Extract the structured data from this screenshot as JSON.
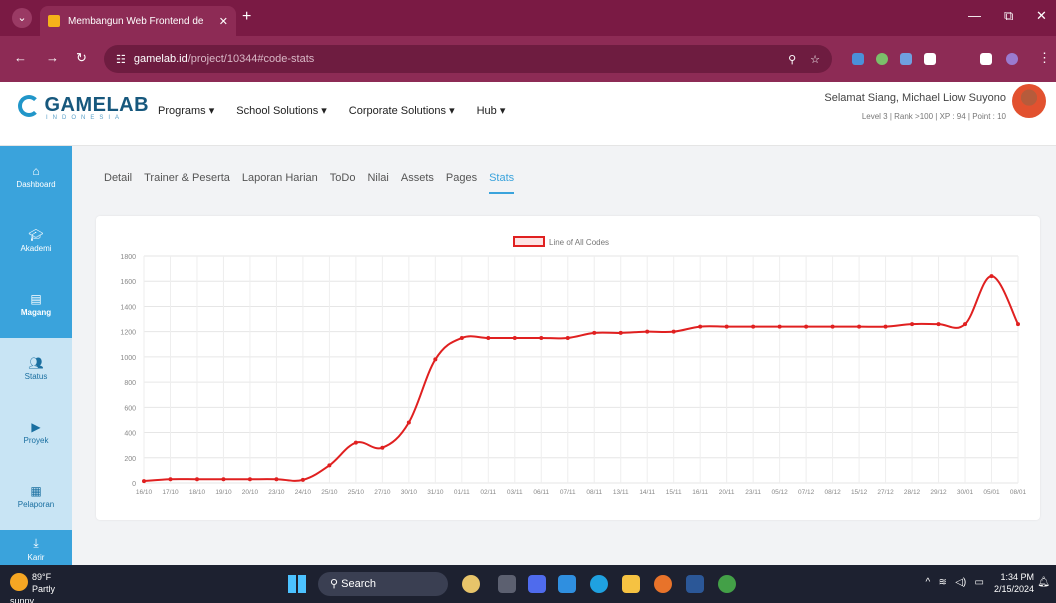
{
  "browser": {
    "tab_title": "Membangun Web Frontend de",
    "url_domain": "gamelab.id",
    "url_path": "/project/10344#code-stats"
  },
  "site": {
    "logo_text": "GAMELAB",
    "logo_sub": "INDONESIA",
    "menu": [
      "Programs ▾",
      "School Solutions ▾",
      "Corporate Solutions ▾",
      "Hub ▾"
    ],
    "user_greeting": "Selamat Siang, Michael Liow Suyono",
    "user_stats": "Level 3  |  Rank >100  |  XP : 94  |  Point : 10"
  },
  "sidebar": {
    "items": [
      {
        "label": "Dashboard",
        "icon": "home-icon"
      },
      {
        "label": "Akademi",
        "icon": "graduation-cap-icon"
      },
      {
        "label": "Magang",
        "icon": "document-icon"
      },
      {
        "label": "Status",
        "icon": "users-icon"
      },
      {
        "label": "Proyek",
        "icon": "play-icon"
      },
      {
        "label": "Pelaporan",
        "icon": "report-icon"
      },
      {
        "label": "Karir",
        "icon": "download-icon"
      }
    ]
  },
  "tabs": [
    "Detail",
    "Trainer & Peserta",
    "Laporan Harian",
    "ToDo",
    "Nilai",
    "Assets",
    "Pages",
    "Stats"
  ],
  "active_tab": "Stats",
  "chart_data": {
    "type": "line",
    "legend": "Line of All Codes",
    "legend_position": "top-center",
    "line_color": "#e02020",
    "grid": true,
    "ylim": [
      0,
      1800
    ],
    "yticks": [
      0,
      200,
      400,
      600,
      800,
      1000,
      1200,
      1400,
      1600,
      1800
    ],
    "categories": [
      "16/10",
      "17/10",
      "18/10",
      "19/10",
      "20/10",
      "23/10",
      "24/10",
      "25/10",
      "25/10",
      "27/10",
      "30/10",
      "31/10",
      "01/11",
      "02/11",
      "03/11",
      "06/11",
      "07/11",
      "08/11",
      "13/11",
      "14/11",
      "15/11",
      "16/11",
      "20/11",
      "23/11",
      "05/12",
      "07/12",
      "08/12",
      "15/12",
      "27/12",
      "28/12",
      "29/12",
      "30/01",
      "05/01",
      "08/01"
    ],
    "values": [
      15,
      30,
      30,
      30,
      30,
      30,
      25,
      140,
      320,
      280,
      480,
      980,
      1150,
      1150,
      1150,
      1150,
      1150,
      1190,
      1190,
      1200,
      1200,
      1240,
      1240,
      1240,
      1240,
      1240,
      1240,
      1240,
      1240,
      1260,
      1260,
      1260,
      1640,
      1260
    ]
  },
  "taskbar": {
    "temp": "89°F",
    "weather": "Partly sunny",
    "search": "Search",
    "time": "1:34 PM",
    "date": "2/15/2024"
  }
}
